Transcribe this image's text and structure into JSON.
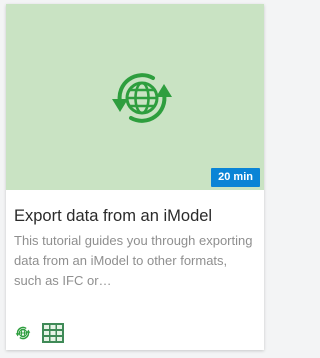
{
  "card": {
    "duration_badge": "20 min",
    "title": "Export data from an iModel",
    "description": "This tutorial guides you through exporting data from an iModel to other formats, such as IFC or…"
  },
  "icons": {
    "hero": "globe-sync-icon",
    "tags": [
      "globe-sync-icon",
      "data-table-icon"
    ]
  },
  "colors": {
    "thumbnail_bg": "#c9e3c3",
    "icon_green": "#2e9e3e",
    "badge_bg": "#0a84d6",
    "title_text": "#2a2a2a",
    "description_text": "#8f8f8f"
  }
}
